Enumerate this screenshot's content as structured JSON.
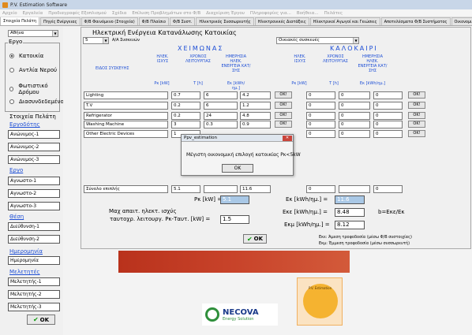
{
  "window": {
    "title": "P.V. Estimation Software"
  },
  "menu": [
    "Αρχείο",
    "Εργαλεία",
    "Προδιαγραφές Εξοπλισμού",
    "Σχέδια",
    "Επίλυση Προβλημάτων στο Φ/Β",
    "Διαχείριση Έργου",
    "Πληροφορίες για...",
    "Βοήθεια...",
    "Πελάτες"
  ],
  "tabs": [
    "Στοιχεία Πελάτη",
    "Πηγές Ενέργειας",
    "Φ/Β Φαινόμενο (Στοιχεία)",
    "Φ/Β Πλαίσιο",
    "Φ/Β Συστ.",
    "Ηλεκτρικός Συσσωρευτής",
    "Ηλεκτρονικές Διατάξεις",
    "Ηλεκτρικοί Αγωγοί και Γειώσεις",
    "Αποτελέσματα Φ/Β Συστήματος",
    "Οικονομική Α"
  ],
  "left": {
    "city": "Αθήνα",
    "project_group": "Εργο",
    "radios": [
      "Κατοικία",
      "Αντλία Νερού",
      "Φωτιστικό Δρόμου",
      "Διασυνδεδεμένο"
    ],
    "client_section": "Στοιχεία Πελάτη",
    "client_link": "Εργοδότης",
    "client_fields": [
      "Ανώνυμος-1",
      "Ανώνυμος-2",
      "Ανώνυμος-3"
    ],
    "project_link": "Εργο",
    "project_fields": [
      "Αγνωστο-1",
      "Αγνωστο-2",
      "Αγνωστο-3"
    ],
    "location_link": "Θέση",
    "location_fields": [
      "Διεύθυνση-1",
      "Διεύθυνση-2"
    ],
    "date_link": "Ημερομηνία",
    "date_field": "Ημερομηνία",
    "engineer_link": "Μελετητές",
    "engineer_fields": [
      "Μελετητής-1",
      "Μελετητής-2",
      "Μελετητής-3"
    ],
    "ok": "OK"
  },
  "form": {
    "title": "Ηλεκτρική Ενέργεια Κατανάλωσης Κατοικίας",
    "count": "5",
    "count_label": "Α/Α Συσκευών",
    "devices_dropdown": "Οικιακές συσκευές",
    "winter": "ΧΕΙΜΩΝΑΣ",
    "summer": "ΚΑΛΟΚΑΙΡΙ",
    "device_header": "ΕΙΔΟΣ ΣΥΣΚΕΥΗΣ",
    "headers_w": [
      "ΗΛΕΚ. ΙΣΧΥΣ",
      "ΧΡΟΝΟΣ ΛΕΙΤΟΥΡΓΙΑΣ",
      "ΗΜΕΡΗΣΙΑ ΗΛΕΚ. ΕΝΕΡΓΕΙΑ ΚΑΤ/ΣΗΣ"
    ],
    "units_w": [
      "Pκ [kW]",
      "T [h]",
      "Eκ [kWh/ημ.]"
    ],
    "headers_s": [
      "ΗΛΕΚ. ΙΣΧΥΣ",
      "ΧΡΟΝΟΣ ΛΕΙΤΟΥΡΓΙΑΣ",
      "ΗΜΕΡΗΣΙΑ ΗΛΕΚ. ΕΝΕΡΓΕΙΑ ΚΑΤ/ΣΗΣ"
    ],
    "units_s": [
      "Pκ [kW]",
      "T [h]",
      "Eκ [kWh/ημ.]"
    ],
    "rows": [
      {
        "device": "Lighting",
        "p": "0.7",
        "t": "6",
        "e": "4.2",
        "sp": "0",
        "st": "0",
        "se": "0"
      },
      {
        "device": "T.V",
        "p": "0.2",
        "t": "6",
        "e": "1.2",
        "sp": "0",
        "st": "0",
        "se": "0"
      },
      {
        "device": "Refrigerator",
        "p": "0.2",
        "t": "24",
        "e": "4.8",
        "sp": "0",
        "st": "0",
        "se": "0"
      },
      {
        "device": "Washing Machine",
        "p": "3",
        "t": "0.3",
        "e": "0.9",
        "sp": "0",
        "st": "0",
        "se": "0"
      },
      {
        "device": "Other Electric Devices",
        "p": "1",
        "t": "",
        "e": "",
        "sp": "0",
        "st": "0",
        "se": "0"
      }
    ],
    "row_button": "OK!",
    "total_label": "Σύνολο επιπλής",
    "total": {
      "p": "5.1",
      "e": "11.6",
      "sp": "0",
      "se": "0"
    },
    "pk_label": "Pκ [kW] =",
    "pk_value": "5.1",
    "ek_label": "Eκ [kWh/ημ.] =",
    "ek_value": "11.6",
    "eke_label": "Eκε [kWh/ημ.] =",
    "eke_value": "8.48",
    "ekm_label": "Eκμ [kWh/ημ.] =",
    "ekm_value": "8.12",
    "b_formula": "b=Eκε/Eκ",
    "max_label_1": "Μαχ απαιτ. ηλεκτ. ισχύς",
    "max_label_2": "ταυτοχρ. λειτουργ. Pκ-Ταυτ. [kW] =",
    "max_value": "1.5",
    "ok": "OK",
    "note_1": "Eκε: Άμεση τροφοδοσία (μέσω Φ/Β συστοιχίας)",
    "note_2": "Eκμ: Έμμεση τροφοδοσία (μέσω συσσωρευτή)"
  },
  "dialog": {
    "title": "Ppv_estimation",
    "message": "Μέγιστη οικονομική επιλογή κατοικίας Pκ<5kW",
    "ok": "OK"
  },
  "logos": {
    "necova": "NECOVA",
    "necova_sub": "Energy Solution",
    "pv": "P.V. Estimation"
  },
  "colors": {
    "link": "#1e4fd6",
    "value_highlight": "#a9c8e6",
    "ok_check": "#0a9a0a"
  }
}
